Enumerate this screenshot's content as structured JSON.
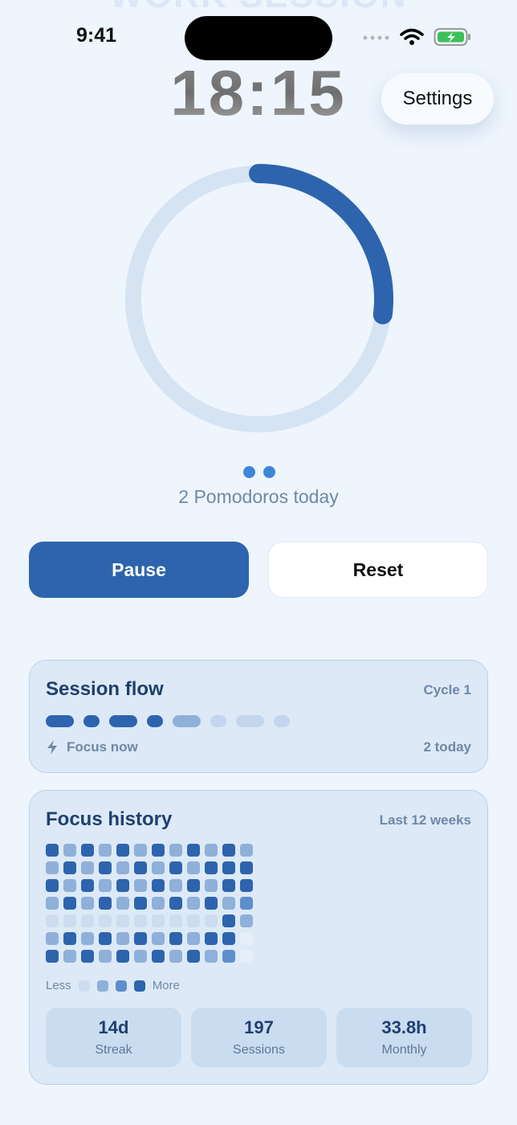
{
  "header": {
    "ghost_title": "WORK SESSION",
    "status_time": "9:41",
    "timer": "18:15",
    "settings_label": "Settings"
  },
  "progress": {
    "fraction": 0.27
  },
  "pomodoro": {
    "count_dots": 2,
    "label": "2 Pomodoros today"
  },
  "actions": {
    "pause_label": "Pause",
    "reset_label": "Reset"
  },
  "session_flow": {
    "title": "Session flow",
    "cycle": "Cycle 1",
    "segments": [
      "work",
      "break",
      "work",
      "break",
      "work",
      "break",
      "work",
      "break"
    ],
    "segment_states": [
      "done",
      "done",
      "done",
      "done",
      "current",
      "upcoming",
      "upcoming",
      "upcoming"
    ],
    "status": "Focus now",
    "today": "2 today"
  },
  "focus_history": {
    "title": "Focus history",
    "range": "Last 12 weeks",
    "grid_levels": [
      [
        4,
        2,
        4,
        2,
        4,
        2,
        4,
        2,
        4,
        2,
        4,
        2
      ],
      [
        2,
        4,
        2,
        4,
        2,
        4,
        2,
        4,
        2,
        4,
        4,
        4
      ],
      [
        4,
        2,
        4,
        2,
        4,
        2,
        4,
        2,
        4,
        2,
        4,
        4
      ],
      [
        2,
        4,
        2,
        4,
        2,
        4,
        2,
        4,
        2,
        4,
        2,
        3
      ],
      [
        1,
        1,
        1,
        1,
        1,
        1,
        1,
        1,
        1,
        1,
        4,
        2
      ],
      [
        2,
        4,
        2,
        4,
        2,
        4,
        2,
        4,
        2,
        4,
        4,
        0
      ],
      [
        4,
        2,
        4,
        2,
        4,
        2,
        4,
        2,
        4,
        2,
        3,
        0
      ]
    ],
    "legend_less": "Less",
    "legend_more": "More",
    "stats": [
      {
        "value": "14d",
        "label": "Streak"
      },
      {
        "value": "197",
        "label": "Sessions"
      },
      {
        "value": "33.8h",
        "label": "Monthly"
      }
    ]
  },
  "colors": {
    "accent": "#2d64ad",
    "level_1": "#cddcef",
    "level_2": "#8fb0d9",
    "level_3": "#5d8fcc",
    "level_4": "#2d64ad",
    "level_empty": "#e6eef8",
    "battery": "#3cc05a"
  }
}
